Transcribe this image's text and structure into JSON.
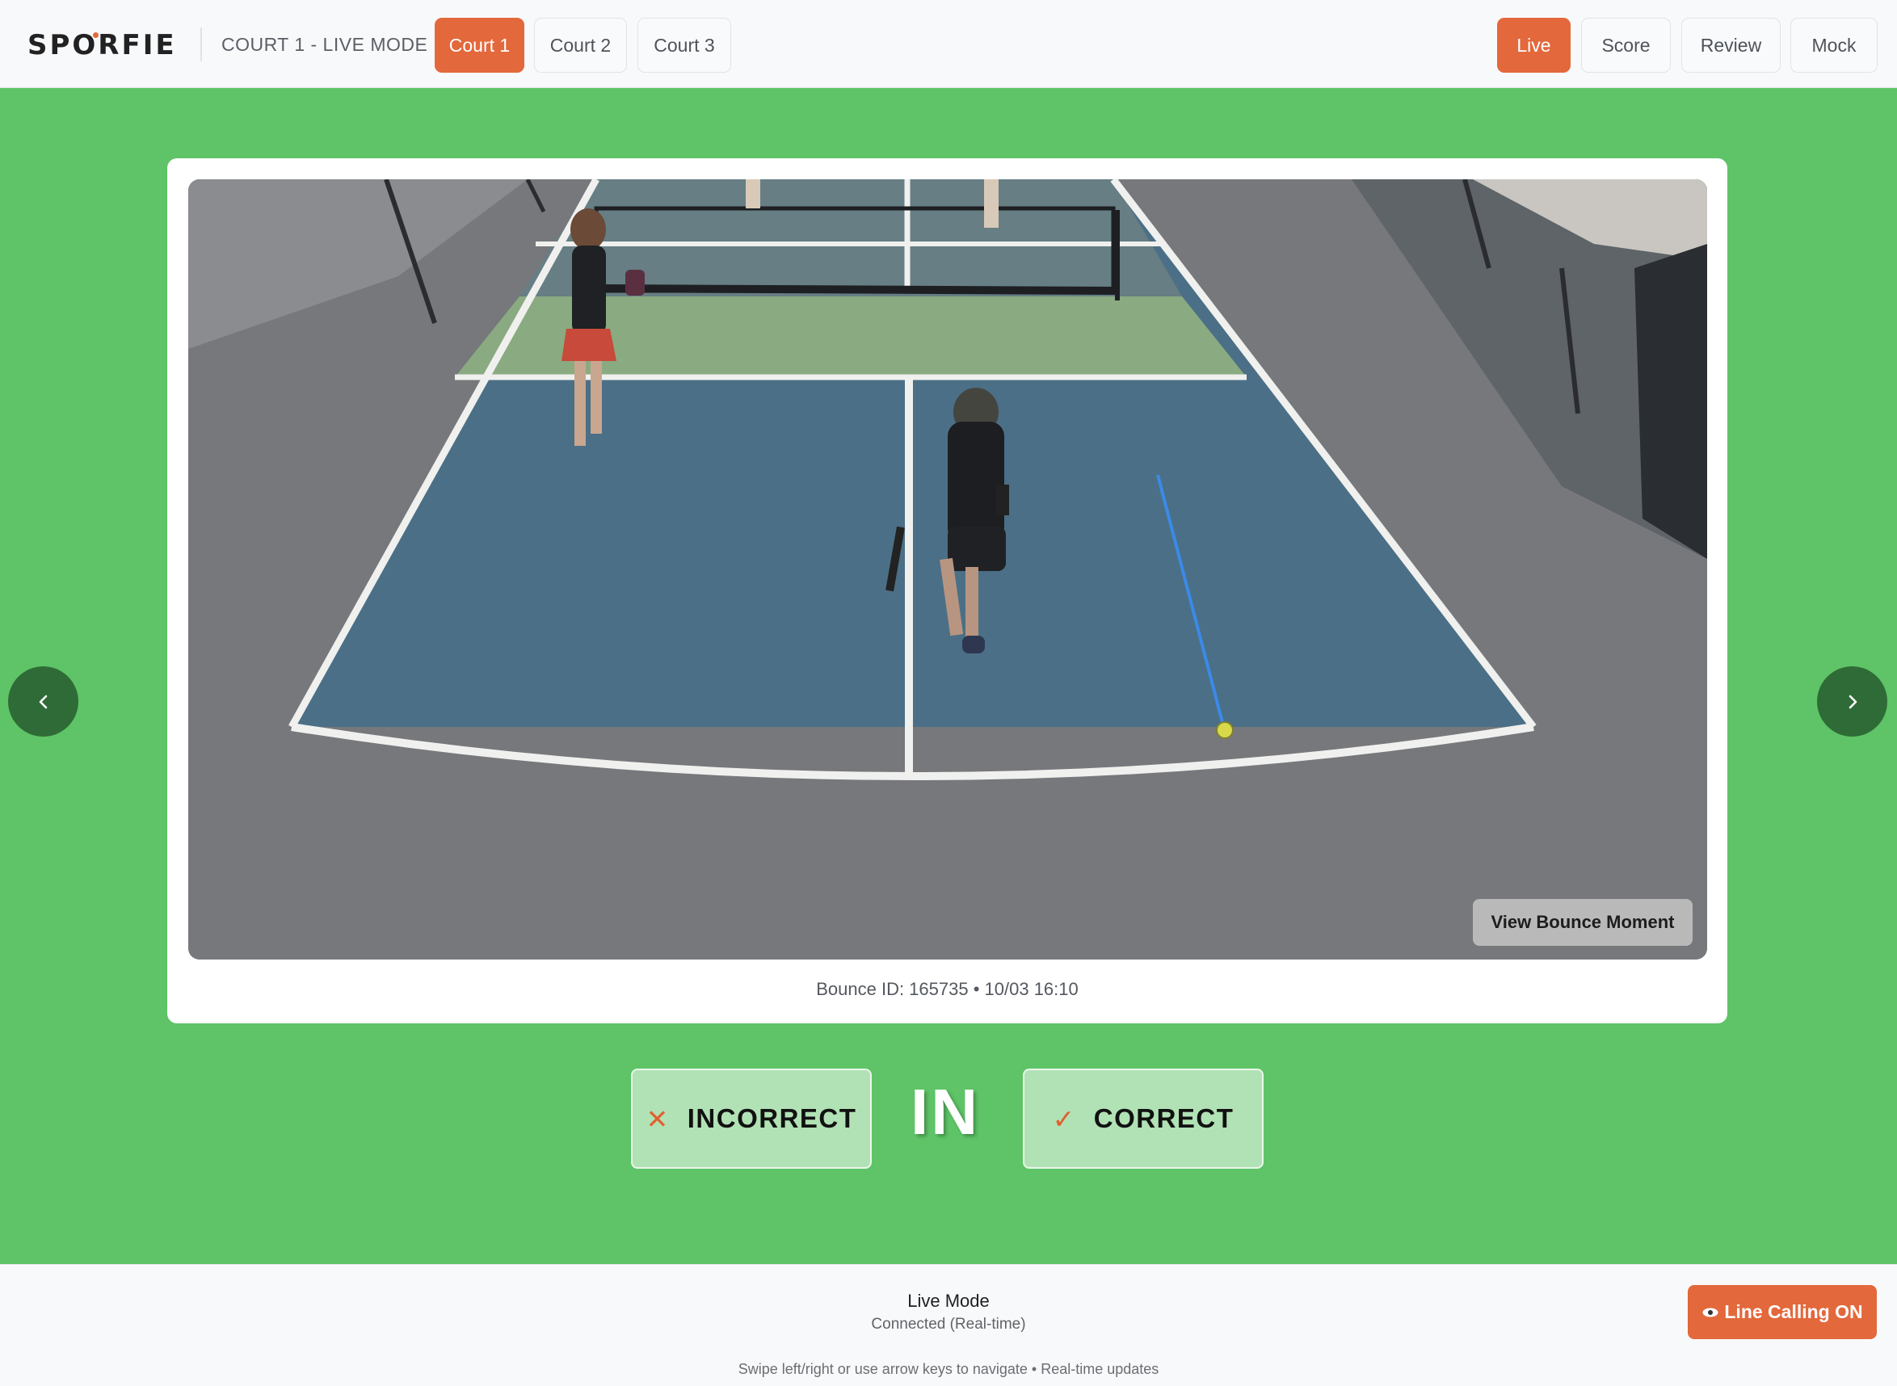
{
  "header": {
    "logo_text": "SPORFIE",
    "mode_title": "COURT 1 - LIVE MODE",
    "court_tabs": [
      {
        "label": "Court 1",
        "active": true
      },
      {
        "label": "Court 2",
        "active": false
      },
      {
        "label": "Court 3",
        "active": false
      }
    ],
    "mode_tabs": [
      {
        "label": "Live",
        "active": true
      },
      {
        "label": "Score",
        "active": false
      },
      {
        "label": "Review",
        "active": false
      },
      {
        "label": "Mock",
        "active": false
      }
    ]
  },
  "video": {
    "view_bounce_label": "View Bounce Moment",
    "bounce_meta": "Bounce ID: 165735 • 10/03 16:10",
    "scene": "pickleball-court-camera-feed"
  },
  "navigation": {
    "prev_icon": "chevron-left-icon",
    "next_icon": "chevron-right-icon"
  },
  "verdict": {
    "call": "IN",
    "incorrect_label": "INCORRECT",
    "incorrect_icon": "✕",
    "correct_label": "CORRECT",
    "correct_icon": "✓"
  },
  "footer": {
    "status_title": "Live Mode",
    "connection": "Connected (Real-time)",
    "hint": "Swipe left/right or use arrow keys to navigate • Real-time updates",
    "line_calling_label": "Line Calling ON",
    "line_calling_icon": "eye-icon"
  },
  "colors": {
    "accent": "#e3683c",
    "background": "#5ec467",
    "nav_arrow": "#2f6b37",
    "verdict_button": "#b1e2b5",
    "court_blue": "#4b6f86",
    "court_green": "#8aaa82"
  }
}
